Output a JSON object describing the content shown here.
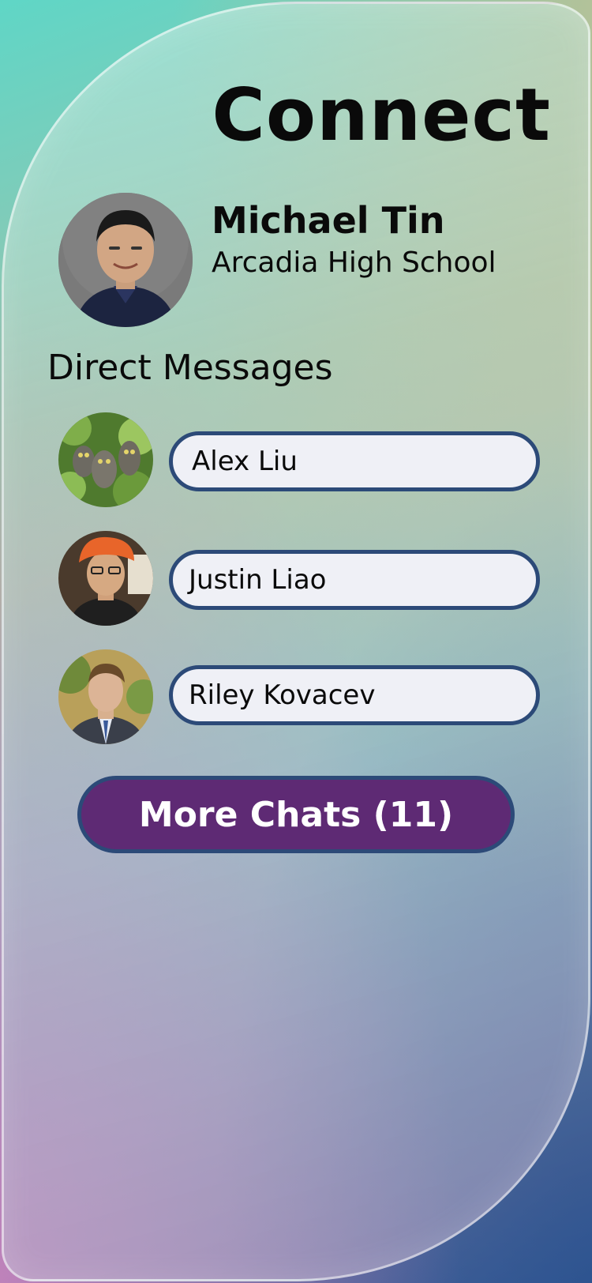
{
  "app": {
    "title": "Connect"
  },
  "profile": {
    "name": "Michael Tin",
    "school": "Arcadia High School",
    "avatar_icon": "profile-photo"
  },
  "direct_messages": {
    "heading": "Direct Messages",
    "chats": [
      {
        "name": "Alex Liu",
        "avatar_icon": "owl-photo"
      },
      {
        "name": "Justin Liao",
        "avatar_icon": "person-photo"
      },
      {
        "name": "Riley Kovacev",
        "avatar_icon": "person-photo"
      }
    ]
  },
  "more_chats": {
    "label": "More Chats (11)"
  },
  "colors": {
    "pill_border": "#2c4a78",
    "pill_fill": "#eff0f6",
    "button_fill": "#5e2a74",
    "text": "#0a0a0a"
  }
}
